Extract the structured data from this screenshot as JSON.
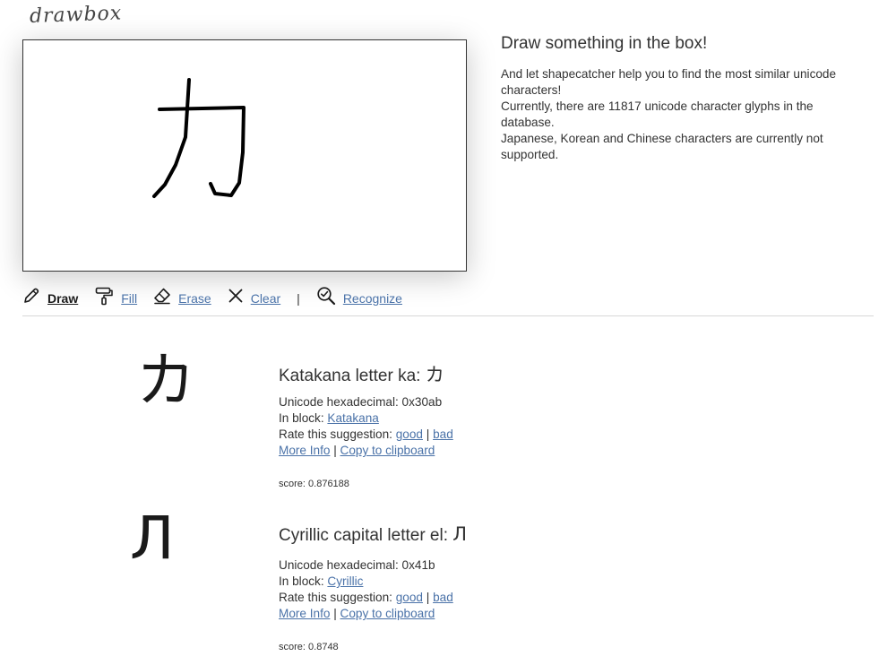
{
  "app": {
    "logo": "drawbox"
  },
  "intro": {
    "title": "Draw something in the box!",
    "line1": "And let shapecatcher help you to find the most similar unicode characters!",
    "line2": "Currently, there are 11817 unicode character glyphs in the database.",
    "line3": "Japanese, Korean and Chinese characters are currently not supported."
  },
  "toolbar": {
    "draw": {
      "label": "Draw",
      "icon": "pencil-icon",
      "active": true
    },
    "fill": {
      "label": "Fill",
      "icon": "paint-roller-icon",
      "active": false
    },
    "erase": {
      "label": "Erase",
      "icon": "eraser-icon",
      "active": false
    },
    "clear": {
      "label": "Clear",
      "icon": "close-icon",
      "active": false
    },
    "separator": "|",
    "recognize": {
      "label": "Recognize",
      "icon": "magnifier-check-icon",
      "active": false
    }
  },
  "results": [
    {
      "glyph": "カ",
      "name": "Katakana letter ka:",
      "hex_label": "Unicode hexadecimal:",
      "hex": "0x30ab",
      "block_label": "In block:",
      "block": "Katakana",
      "rate_label": "Rate this suggestion:",
      "good": "good",
      "sep": "|",
      "bad": "bad",
      "more_info": "More Info",
      "copy": "Copy to clipboard",
      "score_label": "score:",
      "score": "0.876188"
    },
    {
      "glyph": "Л",
      "name": "Cyrillic capital letter el:",
      "hex_label": "Unicode hexadecimal:",
      "hex": "0x41b",
      "block_label": "In block:",
      "block": "Cyrillic",
      "rate_label": "Rate this suggestion:",
      "good": "good",
      "sep": "|",
      "bad": "bad",
      "more_info": "More Info",
      "copy": "Copy to clipboard",
      "score_label": "score:",
      "score": "0.8748"
    }
  ],
  "colors": {
    "link": "#4a72a8",
    "text": "#333333",
    "border": "#333333",
    "divider": "#d8d8d8",
    "stroke": "#000000"
  }
}
